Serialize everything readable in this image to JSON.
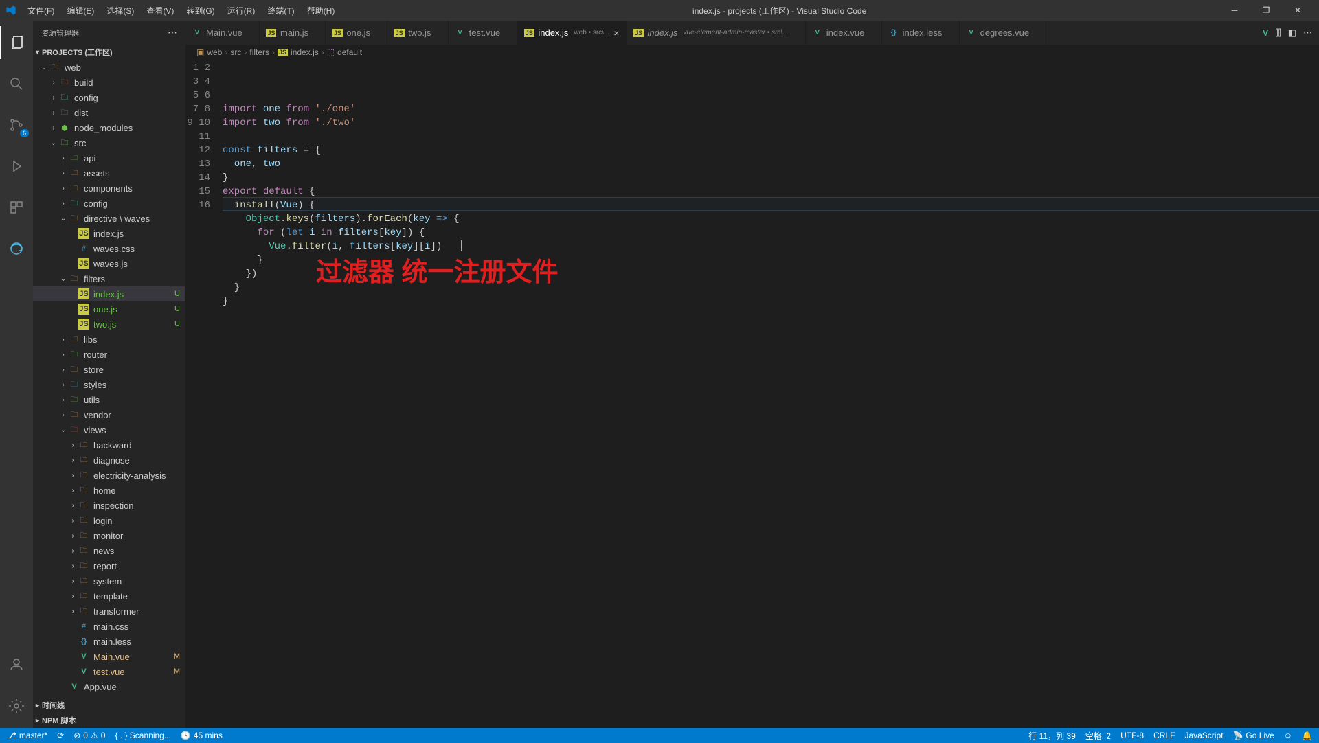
{
  "title_bar": {
    "menus": [
      "文件(F)",
      "编辑(E)",
      "选择(S)",
      "查看(V)",
      "转到(G)",
      "运行(R)",
      "终端(T)",
      "帮助(H)"
    ],
    "title": "index.js - projects (工作区) - Visual Studio Code"
  },
  "sidebar": {
    "title": "资源管理器",
    "section": "PROJECTS (工作区)",
    "sections_bottom": [
      "时间线",
      "NPM 脚本"
    ]
  },
  "tree": [
    {
      "name": "web",
      "type": "folder",
      "depth": 0,
      "open": true,
      "dot": true
    },
    {
      "name": "build",
      "type": "folder",
      "depth": 1,
      "icon": "folder-red"
    },
    {
      "name": "config",
      "type": "folder",
      "depth": 1,
      "icon": "folder-teal"
    },
    {
      "name": "dist",
      "type": "folder",
      "depth": 1,
      "icon": "folder-gray"
    },
    {
      "name": "node_modules",
      "type": "folder",
      "depth": 1,
      "icon": "module"
    },
    {
      "name": "src",
      "type": "folder",
      "depth": 1,
      "open": true,
      "icon": "folder-green",
      "dot": true
    },
    {
      "name": "api",
      "type": "folder",
      "depth": 2,
      "icon": "folder-green"
    },
    {
      "name": "assets",
      "type": "folder",
      "depth": 2,
      "icon": "folder-yellow"
    },
    {
      "name": "components",
      "type": "folder",
      "depth": 2,
      "icon": "folder-yellow"
    },
    {
      "name": "config",
      "type": "folder",
      "depth": 2,
      "icon": "folder-teal"
    },
    {
      "name": "directive \\ waves",
      "type": "folder",
      "depth": 2,
      "open": true,
      "icon": "folder"
    },
    {
      "name": "index.js",
      "type": "file",
      "depth": 3,
      "icon": "js"
    },
    {
      "name": "waves.css",
      "type": "file",
      "depth": 3,
      "icon": "css"
    },
    {
      "name": "waves.js",
      "type": "file",
      "depth": 3,
      "icon": "js"
    },
    {
      "name": "filters",
      "type": "folder",
      "depth": 2,
      "open": true,
      "icon": "folder",
      "dot": true
    },
    {
      "name": "index.js",
      "type": "file",
      "depth": 3,
      "icon": "js",
      "selected": true,
      "status": "U",
      "statusColor": "#6cc04a"
    },
    {
      "name": "one.js",
      "type": "file",
      "depth": 3,
      "icon": "js",
      "status": "U",
      "statusColor": "#6cc04a"
    },
    {
      "name": "two.js",
      "type": "file",
      "depth": 3,
      "icon": "js",
      "status": "U",
      "statusColor": "#6cc04a"
    },
    {
      "name": "libs",
      "type": "folder",
      "depth": 2,
      "icon": "folder"
    },
    {
      "name": "router",
      "type": "folder",
      "depth": 2,
      "icon": "folder-green"
    },
    {
      "name": "store",
      "type": "folder",
      "depth": 2,
      "icon": "folder"
    },
    {
      "name": "styles",
      "type": "folder",
      "depth": 2,
      "icon": "folder-blue"
    },
    {
      "name": "utils",
      "type": "folder",
      "depth": 2,
      "icon": "folder-green"
    },
    {
      "name": "vendor",
      "type": "folder",
      "depth": 2,
      "icon": "folder"
    },
    {
      "name": "views",
      "type": "folder",
      "depth": 2,
      "open": true,
      "icon": "folder-red",
      "dot": true
    },
    {
      "name": "backward",
      "type": "folder",
      "depth": 3,
      "icon": "folder"
    },
    {
      "name": "diagnose",
      "type": "folder",
      "depth": 3,
      "icon": "folder"
    },
    {
      "name": "electricity-analysis",
      "type": "folder",
      "depth": 3,
      "icon": "folder"
    },
    {
      "name": "home",
      "type": "folder",
      "depth": 3,
      "icon": "folder"
    },
    {
      "name": "inspection",
      "type": "folder",
      "depth": 3,
      "icon": "folder"
    },
    {
      "name": "login",
      "type": "folder",
      "depth": 3,
      "icon": "folder"
    },
    {
      "name": "monitor",
      "type": "folder",
      "depth": 3,
      "icon": "folder"
    },
    {
      "name": "news",
      "type": "folder",
      "depth": 3,
      "icon": "folder"
    },
    {
      "name": "report",
      "type": "folder",
      "depth": 3,
      "icon": "folder"
    },
    {
      "name": "system",
      "type": "folder",
      "depth": 3,
      "icon": "folder"
    },
    {
      "name": "template",
      "type": "folder",
      "depth": 3,
      "icon": "folder"
    },
    {
      "name": "transformer",
      "type": "folder",
      "depth": 3,
      "icon": "folder"
    },
    {
      "name": "main.css",
      "type": "file",
      "depth": 3,
      "icon": "css"
    },
    {
      "name": "main.less",
      "type": "file",
      "depth": 3,
      "icon": "less"
    },
    {
      "name": "Main.vue",
      "type": "file",
      "depth": 3,
      "icon": "vue",
      "status": "M",
      "statusColor": "#e2c08d"
    },
    {
      "name": "test.vue",
      "type": "file",
      "depth": 3,
      "icon": "vue",
      "status": "M",
      "statusColor": "#e2c08d"
    },
    {
      "name": "App.vue",
      "type": "file",
      "depth": 2,
      "icon": "vue"
    }
  ],
  "tabs": [
    {
      "label": "Main.vue",
      "icon": "vue"
    },
    {
      "label": "main.js",
      "icon": "js"
    },
    {
      "label": "one.js",
      "icon": "js"
    },
    {
      "label": "two.js",
      "icon": "js"
    },
    {
      "label": "test.vue",
      "icon": "vue"
    },
    {
      "label": "index.js",
      "icon": "js",
      "meta": "web • src\\...",
      "active": true
    },
    {
      "label": "index.js",
      "icon": "js",
      "meta": "vue-element-admin-master • src\\...",
      "italic": true
    },
    {
      "label": "index.vue",
      "icon": "vue"
    },
    {
      "label": "index.less",
      "icon": "less"
    },
    {
      "label": "degrees.vue",
      "icon": "vue"
    }
  ],
  "breadcrumb": [
    {
      "icon": "proj",
      "label": "web"
    },
    {
      "label": "src"
    },
    {
      "label": "filters"
    },
    {
      "icon": "js",
      "label": "index.js"
    },
    {
      "icon": "sym",
      "label": "default"
    }
  ],
  "code_lines": 16,
  "overlay": "过滤器 统一注册文件",
  "status": {
    "branch": "master*",
    "sync": "",
    "errors": "0",
    "warnings": "0",
    "scan": "{ . } Scanning...",
    "time": "45 mins",
    "cursor": "行 11，列 39",
    "spaces": "空格: 2",
    "encoding": "UTF-8",
    "eol": "CRLF",
    "lang": "JavaScript",
    "golive": "Go Live"
  },
  "activity_badge": "6"
}
